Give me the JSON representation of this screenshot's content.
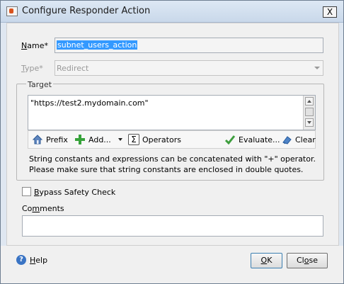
{
  "window": {
    "title": "Configure Responder Action",
    "close_glyph": "X"
  },
  "form": {
    "name_label_pre": "N",
    "name_label_rest": "ame*",
    "name_value": "subnet_users_action",
    "type_label_pre": "T",
    "type_label_rest": "ype*",
    "type_value": "Redirect",
    "target_legend": "Target",
    "target_value": "\"https://test2.mydomain.com\"",
    "hint_line1": "String constants and expressions can be concatenated with \"+\" operator.",
    "hint_line2": "Please make sure that string constants are enclosed in double quotes.",
    "bypass_pre": "B",
    "bypass_rest": "ypass Safety Check",
    "comments_label_pre": "Co",
    "comments_label_mid": "m",
    "comments_label_rest": "ments",
    "comments_value": ""
  },
  "toolbar": {
    "prefix": "Prefix",
    "add": "Add...",
    "operators": "Operators",
    "evaluate": "Evaluate...",
    "clear": "Clear"
  },
  "footer": {
    "help_pre": "H",
    "help_rest": "elp",
    "ok_pre": "O",
    "ok_rest": "K",
    "close_pre": "Cl",
    "close_mid": "o",
    "close_rest": "se"
  },
  "icons": {
    "prefix": "house-icon",
    "add": "plus-icon",
    "operators": "sigma-icon",
    "evaluate": "checkmark-icon",
    "clear": "eraser-icon",
    "help": "help-icon"
  },
  "colors": {
    "selection": "#3399ff",
    "add_plus": "#36a23a",
    "evaluate_check": "#3e9e3e"
  }
}
